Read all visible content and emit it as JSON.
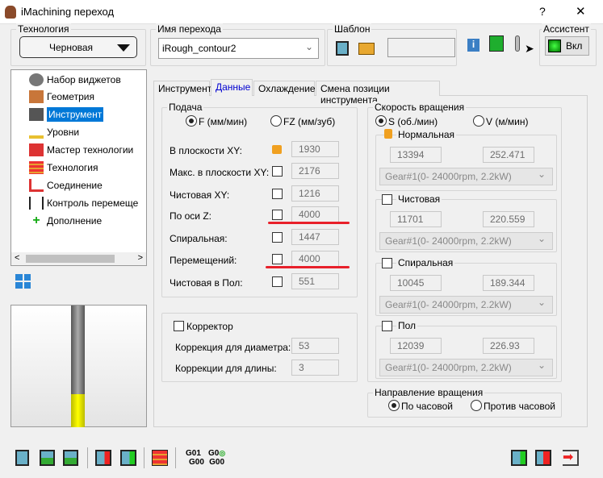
{
  "window": {
    "title": "iMachining переход",
    "help": "?",
    "close": "✕"
  },
  "technology": {
    "label": "Технология",
    "value": "Черновая"
  },
  "step_name": {
    "label": "Имя перехода",
    "value": "iRough_contour2"
  },
  "template": {
    "label": "Шаблон",
    "value": ""
  },
  "assistant": {
    "label": "Ассистент",
    "button": "Вкл"
  },
  "tree": [
    {
      "label": "Набор виджетов"
    },
    {
      "label": "Геометрия"
    },
    {
      "label": "Инструмент",
      "selected": true
    },
    {
      "label": "Уровни"
    },
    {
      "label": "Мастер технологии"
    },
    {
      "label": "Технология"
    },
    {
      "label": "Соединение"
    },
    {
      "label": "Контроль перемеще"
    },
    {
      "label": "Дополнение"
    }
  ],
  "tabs": [
    {
      "label": "Инструмент"
    },
    {
      "label": "Данные",
      "active": true
    },
    {
      "label": "Охлаждение"
    },
    {
      "label": "Смена позиции инструмента"
    }
  ],
  "feed": {
    "label": "Подача",
    "radio_f": "F (мм/мин)",
    "radio_fz": "FZ (мм/зуб)",
    "rows": [
      {
        "label": "В плоскости XY:",
        "value": "1930",
        "lock": true
      },
      {
        "label": "Макс. в плоскости XY:",
        "value": "2176"
      },
      {
        "label": "Чистовая XY:",
        "value": "1216"
      },
      {
        "label": "По оси Z:",
        "value": "4000"
      },
      {
        "label": "Спиральная:",
        "value": "1447"
      },
      {
        "label": "Перемещений:",
        "value": "4000"
      },
      {
        "label": "Чистовая в Пол:",
        "value": "551"
      }
    ]
  },
  "corrector": {
    "label": "Корректор",
    "rows": [
      {
        "label": "Коррекция для диаметра:",
        "value": "53"
      },
      {
        "label": "Коррекции для длины:",
        "value": "3"
      }
    ]
  },
  "spindle": {
    "label": "Скорость вращения",
    "radio_s": "S (об./мин)",
    "radio_v": "V (м/мин)",
    "groups": [
      {
        "label": "Нормальная",
        "s": "13394",
        "v": "252.471",
        "gear": "Gear#1(0- 24000rpm, 2.2kW)"
      },
      {
        "label": "Чистовая",
        "s": "11701",
        "v": "220.559",
        "gear": "Gear#1(0- 24000rpm, 2.2kW)"
      },
      {
        "label": "Спиральная",
        "s": "10045",
        "v": "189.344",
        "gear": "Gear#1(0- 24000rpm, 2.2kW)"
      },
      {
        "label": "Пол",
        "s": "12039",
        "v": "226.93",
        "gear": "Gear#1(0- 24000rpm, 2.2kW)"
      }
    ]
  },
  "direction": {
    "label": "Направление вращения",
    "cw": "По часовой",
    "ccw": "Против часовой"
  },
  "toolbar": {
    "g1a": "G01",
    "g1b": "G00",
    "g2a": "G0",
    "g2b": "G00"
  }
}
